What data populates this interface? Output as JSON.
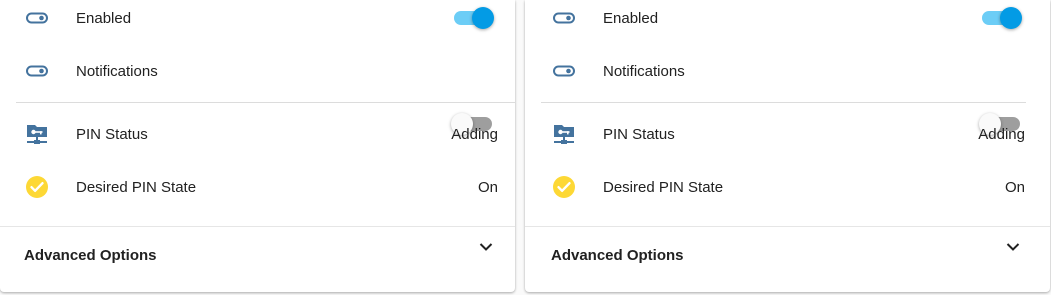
{
  "colors": {
    "icon_blue": "#44739e",
    "check_yellow": "#fdd835",
    "toggle_on_thumb": "#039be5",
    "toggle_on_track": "#6ccdf6",
    "toggle_off_track": "#9e9e9e"
  },
  "cards": [
    {
      "enabled": {
        "label": "Enabled",
        "icon": "toggle-switch-icon",
        "state": "on"
      },
      "notifications": {
        "label": "Notifications",
        "icon": "toggle-switch-icon",
        "state": "off"
      },
      "pin_status": {
        "label": "PIN Status",
        "icon": "lan-key-icon",
        "value": "Adding"
      },
      "desired_pin_state": {
        "label": "Desired PIN State",
        "icon": "check-circle-icon",
        "value": "On"
      },
      "advanced": {
        "label": "Advanced Options",
        "icon": "chevron-down-icon"
      }
    },
    {
      "enabled": {
        "label": "Enabled",
        "icon": "toggle-switch-icon",
        "state": "on"
      },
      "notifications": {
        "label": "Notifications",
        "icon": "toggle-switch-icon",
        "state": "off"
      },
      "pin_status": {
        "label": "PIN Status",
        "icon": "lan-key-icon",
        "value": "Adding"
      },
      "desired_pin_state": {
        "label": "Desired PIN State",
        "icon": "check-circle-icon",
        "value": "On"
      },
      "advanced": {
        "label": "Advanced Options",
        "icon": "chevron-down-icon"
      }
    }
  ]
}
